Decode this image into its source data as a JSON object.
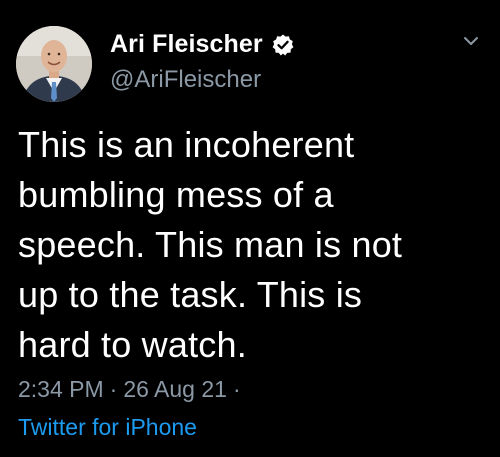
{
  "tweet": {
    "author": {
      "display_name": "Ari Fleischer",
      "handle": "@AriFleischer",
      "verified": true,
      "avatar_icon": "profile-photo"
    },
    "text": "This is an incoherent\nbumbling mess of a\nspeech.  This man is not\nup to the task. This is\nhard to watch.",
    "time": "2:34 PM",
    "separator": "·",
    "date": "26 Aug 21",
    "source": "Twitter for iPhone",
    "menu_icon": "chevron-down-icon"
  },
  "colors": {
    "background": "#000000",
    "text": "#ffffff",
    "secondary": "#8b98a5",
    "link": "#1d9bf0"
  }
}
